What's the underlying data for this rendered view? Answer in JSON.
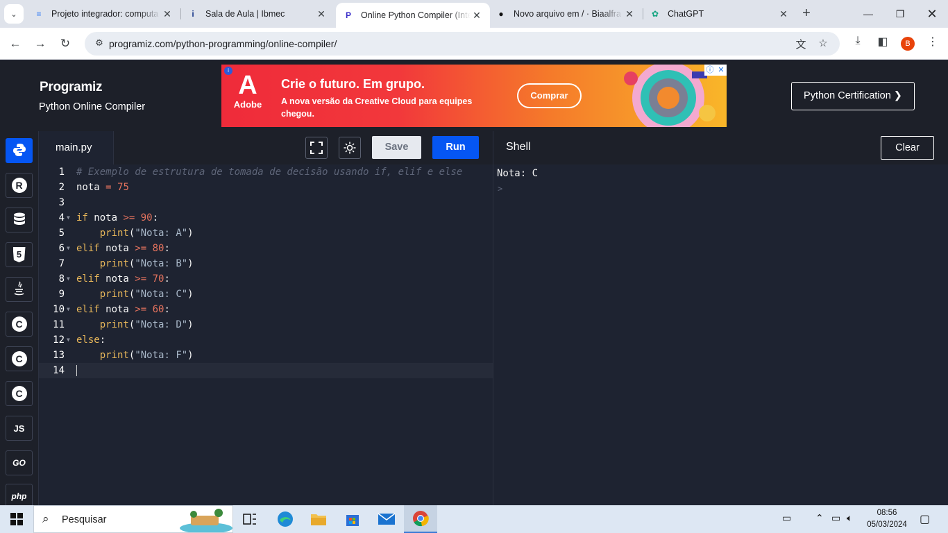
{
  "browser": {
    "tabs": [
      {
        "title": "Projeto integrador: computa",
        "favicon": "docs-icon",
        "color": "#4285f4"
      },
      {
        "title": "Sala de Aula | Ibmec",
        "favicon": "ibmec-icon",
        "color": "#1a3a8a"
      },
      {
        "title": "Online Python Compiler (Inte",
        "favicon": "programiz-icon",
        "color": "#3b2fc9"
      },
      {
        "title": "Novo arquivo em / · Biaalfra",
        "favicon": "github-icon",
        "color": "#111111"
      },
      {
        "title": "ChatGPT",
        "favicon": "chatgpt-icon",
        "color": "#10a37f"
      }
    ],
    "url": "programiz.com/python-programming/online-compiler/",
    "profile_initial": "B"
  },
  "header": {
    "logo": "Programiz",
    "subtitle": "Python Online Compiler",
    "certification_label": "Python Certification ❯"
  },
  "ad": {
    "brand": "Adobe",
    "title": "Crie o futuro. Em grupo.",
    "subtitle": "A nova versão da Creative Cloud para equipes chegou.",
    "cta": "Comprar"
  },
  "rail": {
    "items": [
      {
        "name": "python",
        "label": "",
        "active": true
      },
      {
        "name": "r",
        "label": "R"
      },
      {
        "name": "sql",
        "label": ""
      },
      {
        "name": "html",
        "label": "5"
      },
      {
        "name": "java",
        "label": ""
      },
      {
        "name": "c",
        "label": "C"
      },
      {
        "name": "cpp",
        "label": "C"
      },
      {
        "name": "csharp",
        "label": "C"
      },
      {
        "name": "js",
        "label": "JS"
      },
      {
        "name": "go",
        "label": "GO"
      },
      {
        "name": "php",
        "label": "php"
      }
    ]
  },
  "editor": {
    "filename": "main.py",
    "save_label": "Save",
    "run_label": "Run",
    "lines": [
      [
        [
          "c-com",
          "# Exemplo de estrutura de tomada de decisão usando if, elif e else"
        ]
      ],
      [
        [
          "c-id",
          "nota "
        ],
        [
          "c-op",
          "="
        ],
        [
          "c-id",
          " "
        ],
        [
          "c-num",
          "75"
        ]
      ],
      [],
      [
        [
          "c-kw",
          "if"
        ],
        [
          "c-id",
          " nota "
        ],
        [
          "c-op",
          ">="
        ],
        [
          "c-id",
          " "
        ],
        [
          "c-num",
          "90"
        ],
        [
          "c-p",
          ":"
        ]
      ],
      [
        [
          "c-id",
          "    "
        ],
        [
          "c-fn",
          "print"
        ],
        [
          "c-p",
          "("
        ],
        [
          "c-str",
          "\"Nota: A\""
        ],
        [
          "c-p",
          ")"
        ]
      ],
      [
        [
          "c-kw",
          "elif"
        ],
        [
          "c-id",
          " nota "
        ],
        [
          "c-op",
          ">="
        ],
        [
          "c-id",
          " "
        ],
        [
          "c-num",
          "80"
        ],
        [
          "c-p",
          ":"
        ]
      ],
      [
        [
          "c-id",
          "    "
        ],
        [
          "c-fn",
          "print"
        ],
        [
          "c-p",
          "("
        ],
        [
          "c-str",
          "\"Nota: B\""
        ],
        [
          "c-p",
          ")"
        ]
      ],
      [
        [
          "c-kw",
          "elif"
        ],
        [
          "c-id",
          " nota "
        ],
        [
          "c-op",
          ">="
        ],
        [
          "c-id",
          " "
        ],
        [
          "c-num",
          "70"
        ],
        [
          "c-p",
          ":"
        ]
      ],
      [
        [
          "c-id",
          "    "
        ],
        [
          "c-fn",
          "print"
        ],
        [
          "c-p",
          "("
        ],
        [
          "c-str",
          "\"Nota: C\""
        ],
        [
          "c-p",
          ")"
        ]
      ],
      [
        [
          "c-kw",
          "elif"
        ],
        [
          "c-id",
          " nota "
        ],
        [
          "c-op",
          ">="
        ],
        [
          "c-id",
          " "
        ],
        [
          "c-num",
          "60"
        ],
        [
          "c-p",
          ":"
        ]
      ],
      [
        [
          "c-id",
          "    "
        ],
        [
          "c-fn",
          "print"
        ],
        [
          "c-p",
          "("
        ],
        [
          "c-str",
          "\"Nota: D\""
        ],
        [
          "c-p",
          ")"
        ]
      ],
      [
        [
          "c-kw",
          "else"
        ],
        [
          "c-p",
          ":"
        ]
      ],
      [
        [
          "c-id",
          "    "
        ],
        [
          "c-fn",
          "print"
        ],
        [
          "c-p",
          "("
        ],
        [
          "c-str",
          "\"Nota: F\""
        ],
        [
          "c-p",
          ")"
        ]
      ],
      []
    ],
    "foldable_lines": [
      4,
      6,
      8,
      10,
      12
    ],
    "current_line": 14
  },
  "shell": {
    "title": "Shell",
    "clear_label": "Clear",
    "output": "Nota: C",
    "prompt": ">"
  },
  "taskbar": {
    "search_placeholder": "Pesquisar",
    "time": "08:56",
    "date": "05/03/2024"
  },
  "colors": {
    "accent": "#0556f3",
    "editor_bg": "#1e2331",
    "header_bg": "#1d2029"
  }
}
